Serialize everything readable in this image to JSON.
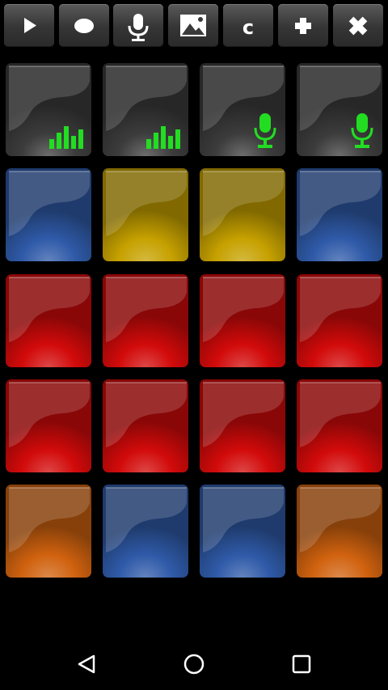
{
  "toolbar": {
    "buttons": [
      {
        "icon": "play-icon"
      },
      {
        "icon": "record-icon"
      },
      {
        "icon": "microphone-icon"
      },
      {
        "icon": "image-icon"
      },
      {
        "icon": "text-c",
        "label": "c"
      },
      {
        "icon": "plus-icon"
      },
      {
        "icon": "close-icon"
      }
    ]
  },
  "pads": [
    [
      {
        "color": "#3c3c3c",
        "icon": "equalizer-icon"
      },
      {
        "color": "#3c3c3c",
        "icon": "equalizer-icon"
      },
      {
        "color": "#3c3c3c",
        "icon": "microphone-icon"
      },
      {
        "color": "#3c3c3c",
        "icon": "microphone-icon"
      }
    ],
    [
      {
        "color": "#2f5aa8",
        "icon": ""
      },
      {
        "color": "#c6a100",
        "icon": ""
      },
      {
        "color": "#c6a100",
        "icon": ""
      },
      {
        "color": "#2f5aa8",
        "icon": ""
      }
    ],
    [
      {
        "color": "#d20a0a",
        "icon": ""
      },
      {
        "color": "#d20a0a",
        "icon": ""
      },
      {
        "color": "#d20a0a",
        "icon": ""
      },
      {
        "color": "#d20a0a",
        "icon": ""
      }
    ],
    [
      {
        "color": "#d20a0a",
        "icon": ""
      },
      {
        "color": "#d20a0a",
        "icon": ""
      },
      {
        "color": "#d20a0a",
        "icon": ""
      },
      {
        "color": "#d20a0a",
        "icon": ""
      }
    ],
    [
      {
        "color": "#d0620f",
        "icon": ""
      },
      {
        "color": "#2f5aa8",
        "icon": ""
      },
      {
        "color": "#2f5aa8",
        "icon": ""
      },
      {
        "color": "#d0620f",
        "icon": ""
      }
    ]
  ],
  "icon_color": "#22dd22",
  "navbar": {
    "buttons": [
      {
        "icon": "back-icon"
      },
      {
        "icon": "home-icon"
      },
      {
        "icon": "recents-icon"
      }
    ]
  }
}
